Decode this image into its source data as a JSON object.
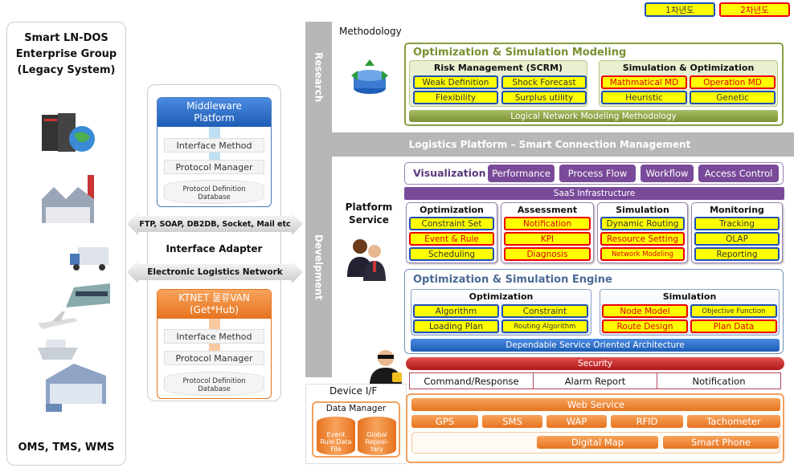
{
  "legend": [
    {
      "label": "1차년도",
      "color": "#1f4fb5"
    },
    {
      "label": "2차년도",
      "color": "#e00000"
    }
  ],
  "legacy": {
    "title": [
      "Smart LN-DOS",
      "Enterprise Group",
      "(Legacy System)"
    ],
    "footer": "OMS, TMS, WMS"
  },
  "middleware": {
    "title": [
      "Middleware",
      "Platform"
    ],
    "rows": [
      "Interface Method",
      "Protocol Manager"
    ],
    "db": [
      "Protocol  Definition",
      "Database"
    ]
  },
  "ktnet": {
    "title": [
      "KTNET 물류VAN",
      "(Get*Hub)"
    ],
    "rows": [
      "Interface Method",
      "Protocol Manager"
    ],
    "db": [
      "Protocol  Definition",
      "Database"
    ]
  },
  "adapter": {
    "arrow1": "FTP, SOAP, DB2DB, Socket,  Mail etc",
    "label": "Interface  Adapter",
    "arrow2": "Electronic Logistics Network"
  },
  "bands": {
    "research": "Research",
    "development": "Develpment",
    "platform": "Logistics Platform – Smart Connection Management"
  },
  "research": {
    "label": "Methodology",
    "modeling": {
      "title": "Optimization & Simulation Modeling",
      "risk": {
        "title": "Risk Management (SCRM)",
        "items": [
          "Weak Definition",
          "Shock Forecast",
          "Flexibility",
          "Surplus utility"
        ]
      },
      "simopt": {
        "title": "Simulation & Optimization",
        "items": [
          "Mathmatical MD",
          "Operation MD",
          "Heuristic",
          "Genetic"
        ]
      },
      "footer": "Logical Network  Modeling Methodology"
    }
  },
  "platform": {
    "label": [
      "Platform",
      "Service"
    ],
    "visualization": {
      "title": "Visualization",
      "buttons": [
        "Performance",
        "Process Flow",
        "Workflow",
        "Access Control"
      ]
    },
    "saas": "SaaS Infrastructure",
    "groups": [
      {
        "title": "Optimization",
        "items": [
          "Constraint Set",
          "Event & Rule",
          "Scheduling"
        ]
      },
      {
        "title": "Assessment",
        "items": [
          "Notification",
          "KPI",
          "Diagnosis"
        ]
      },
      {
        "title": "Simulation",
        "items": [
          "Dynamic Routing",
          "Resource Setting",
          "Network Modeling"
        ]
      },
      {
        "title": "Monitoring",
        "items": [
          "Tracking",
          "OLAP",
          "Reporting"
        ]
      }
    ],
    "engine": {
      "title": "Optimization & Simulation  Engine",
      "opt": {
        "title": "Optimization",
        "items": [
          "Algorithm",
          "Constraint",
          "Loading Plan",
          "Routing  Algorithm"
        ]
      },
      "sim": {
        "title": "Simulation",
        "items": [
          "Node Model",
          "Objective  Function",
          "Route Design",
          "Plan Data"
        ]
      },
      "footer": "Dependable Service Oriented Architecture"
    },
    "security": "Security",
    "commands": [
      "Command/Response",
      "Alarm Report",
      "Notification"
    ]
  },
  "device": {
    "title": "Device I/F",
    "data_manager": {
      "title": "Data Manager",
      "stores": [
        [
          "Event",
          "Rule Data",
          "File"
        ],
        [
          "Global",
          "Reposi-",
          "tary"
        ]
      ]
    },
    "web_service": "Web Service",
    "protocols": [
      "GPS",
      "SMS",
      "WAP",
      "RFID",
      "Tachometer"
    ],
    "apps": [
      "Digital Map",
      "Smart Phone"
    ]
  }
}
